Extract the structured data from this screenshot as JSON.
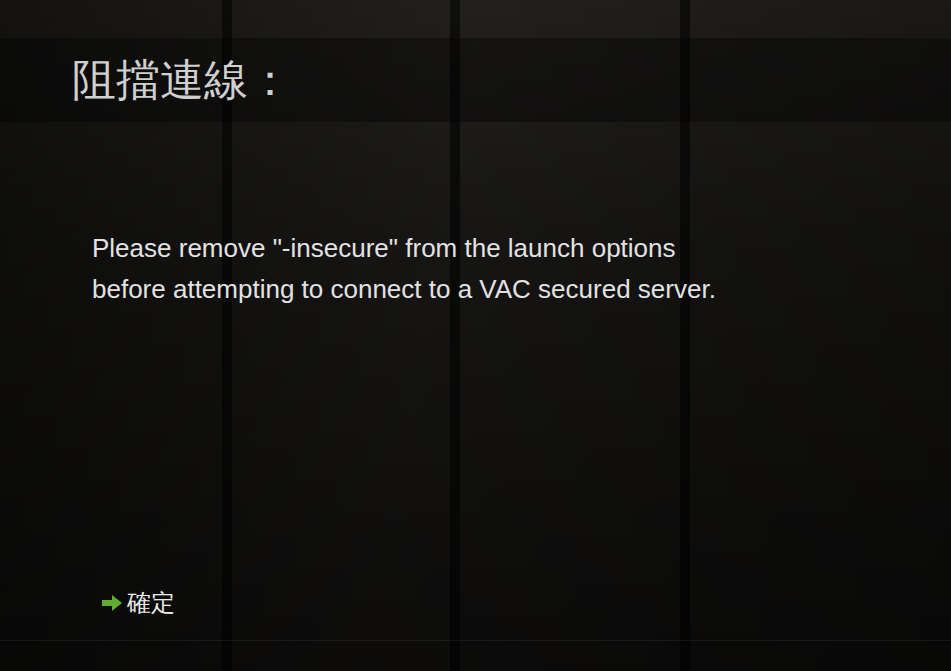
{
  "dialog": {
    "title": "阻擋連線：",
    "message_lines": [
      "Please remove \"-insecure\" from the launch options",
      "before attempting to connect to a VAC secured server."
    ],
    "buttons": [
      {
        "label": "確定",
        "selected": true
      }
    ]
  }
}
